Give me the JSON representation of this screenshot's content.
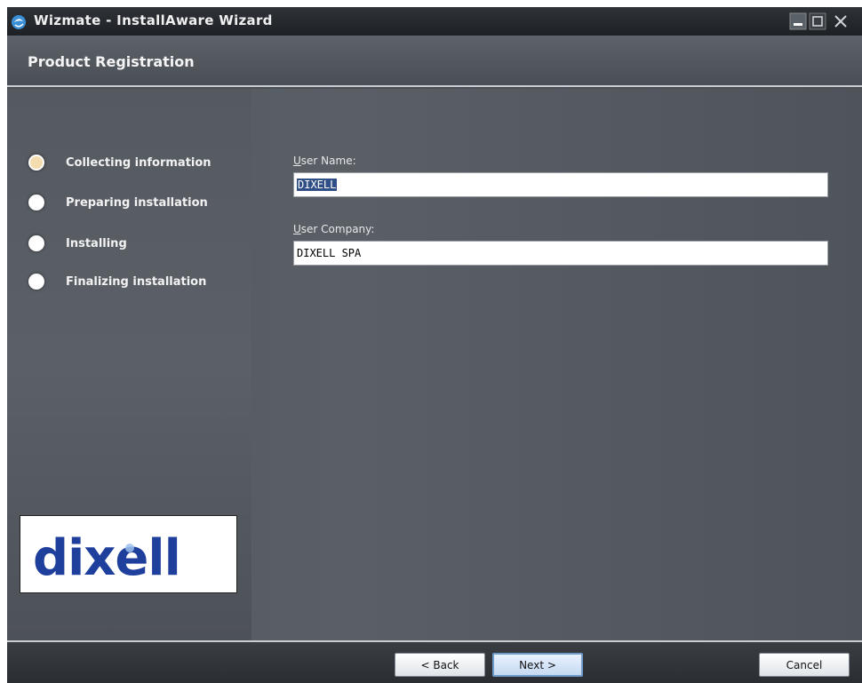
{
  "window": {
    "title": "Wizmate - InstallAware Wizard"
  },
  "header": {
    "title": "Product Registration"
  },
  "steps": [
    {
      "label": "Collecting information",
      "active": true
    },
    {
      "label": "Preparing installation",
      "active": false
    },
    {
      "label": "Installing",
      "active": false
    },
    {
      "label": "Finalizing installation",
      "active": false
    }
  ],
  "form": {
    "user_name": {
      "label_key": "U",
      "label_rest": "ser Name:",
      "value": "DIXELL"
    },
    "user_company": {
      "label_key": "U",
      "label_rest": "ser Company:",
      "value": "DIXELL SPA"
    }
  },
  "logo": {
    "text": "dixell"
  },
  "buttons": {
    "back": "< Back",
    "next": "Next >",
    "cancel": "Cancel"
  },
  "colors": {
    "logo_blue": "#1f3f9c",
    "accent": "#6f9ac9"
  }
}
